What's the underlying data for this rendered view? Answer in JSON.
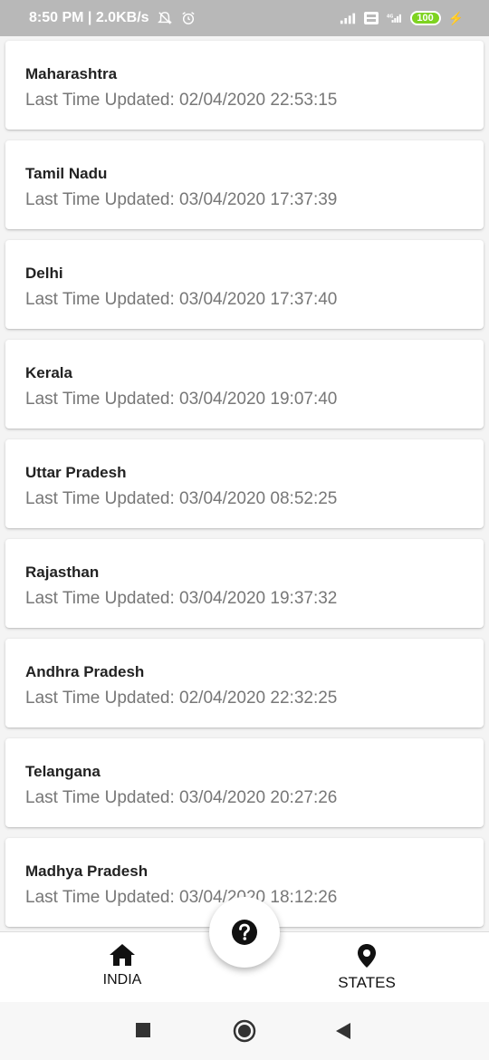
{
  "status_bar": {
    "time_speed": "8:50 PM | 2.0KB/s",
    "battery": "100"
  },
  "states": [
    {
      "name": "Maharashtra",
      "updated": "Last Time Updated: 02/04/2020 22:53:15"
    },
    {
      "name": "Tamil Nadu",
      "updated": "Last Time Updated: 03/04/2020 17:37:39"
    },
    {
      "name": "Delhi",
      "updated": "Last Time Updated: 03/04/2020 17:37:40"
    },
    {
      "name": "Kerala",
      "updated": "Last Time Updated: 03/04/2020 19:07:40"
    },
    {
      "name": "Uttar Pradesh",
      "updated": "Last Time Updated: 03/04/2020 08:52:25"
    },
    {
      "name": "Rajasthan",
      "updated": "Last Time Updated: 03/04/2020 19:37:32"
    },
    {
      "name": "Andhra Pradesh",
      "updated": "Last Time Updated: 02/04/2020 22:32:25"
    },
    {
      "name": "Telangana",
      "updated": "Last Time Updated: 03/04/2020 20:27:26"
    },
    {
      "name": "Madhya Pradesh",
      "updated": "Last Time Updated: 03/04/2020 18:12:26"
    }
  ],
  "bottom_nav": {
    "india_label": "INDIA",
    "india_icon": "home-icon",
    "states_label": "STATES",
    "states_icon": "location-pin-icon",
    "fab_icon": "help-icon"
  },
  "system_nav": {
    "recents_icon": "square-icon",
    "home_icon": "circle-icon",
    "back_icon": "triangle-back-icon"
  }
}
